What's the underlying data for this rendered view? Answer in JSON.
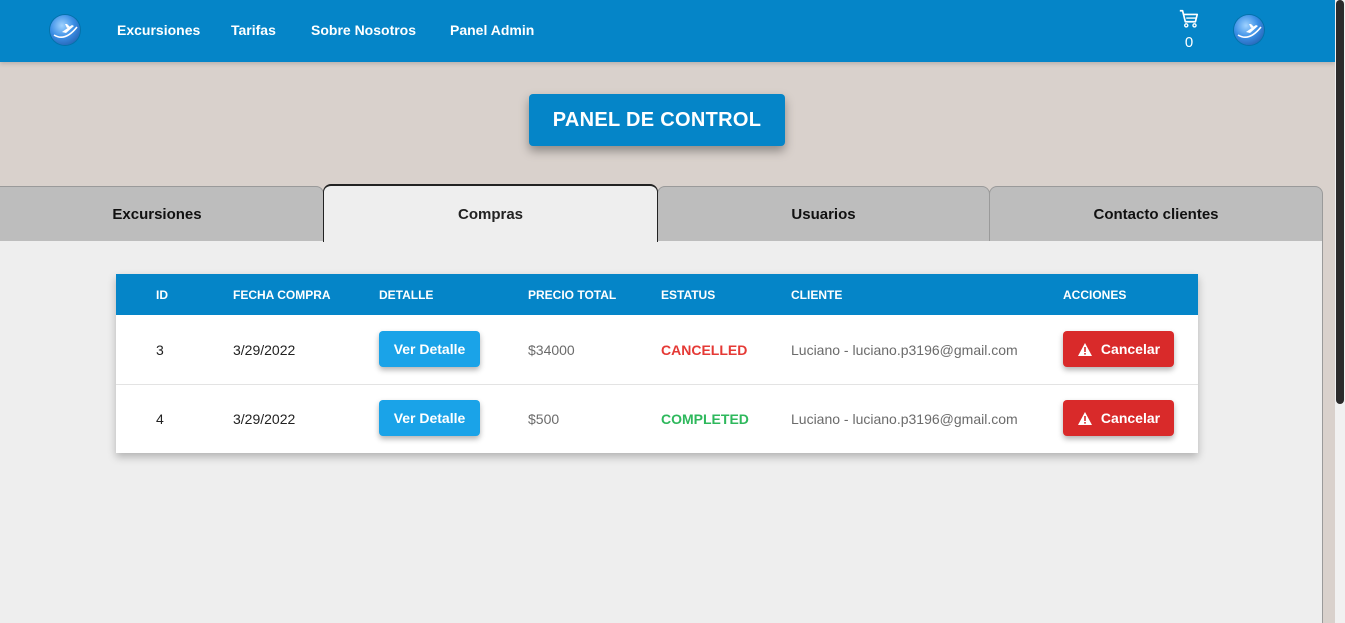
{
  "navbar": {
    "links": [
      "Excursiones",
      "Tarifas",
      "Sobre Nosotros",
      "Panel Admin"
    ],
    "logo_icon": "plane-globe-icon",
    "cart_icon": "shopping-cart-icon",
    "cart_count": "0",
    "profile_icon": "plane-globe-icon",
    "color": "#0585c8"
  },
  "panel_button": "PANEL DE CONTROL",
  "tabs": [
    "Excursiones",
    "Compras",
    "Usuarios",
    "Contacto clientes"
  ],
  "active_tab": "Compras",
  "table": {
    "headers": [
      "ID",
      "FECHA COMPRA",
      "DETALLE",
      "PRECIO TOTAL",
      "ESTATUS",
      "CLIENTE",
      "ACCIONES"
    ],
    "rows": [
      {
        "id": "3",
        "date": "3/29/2022",
        "detail": "Ver Detalle",
        "price": "$34000",
        "status": "CANCELLED",
        "status_color": "#e53935",
        "client": "Luciano - luciano.p3196@gmail.com",
        "action": "Cancelar"
      },
      {
        "id": "4",
        "date": "3/29/2022",
        "detail": "Ver Detalle",
        "price": "$500",
        "status": "COMPLETED",
        "status_color": "#2eb85c",
        "client": "Luciano - luciano.p3196@gmail.com",
        "action": "Cancelar"
      }
    ]
  },
  "colors": {
    "primary": "#0585c8",
    "detail_button": "#1aa3e8",
    "cancel_button": "#d92a2a",
    "page_background": "#d9d1cc",
    "content_background": "#eeeeee"
  }
}
